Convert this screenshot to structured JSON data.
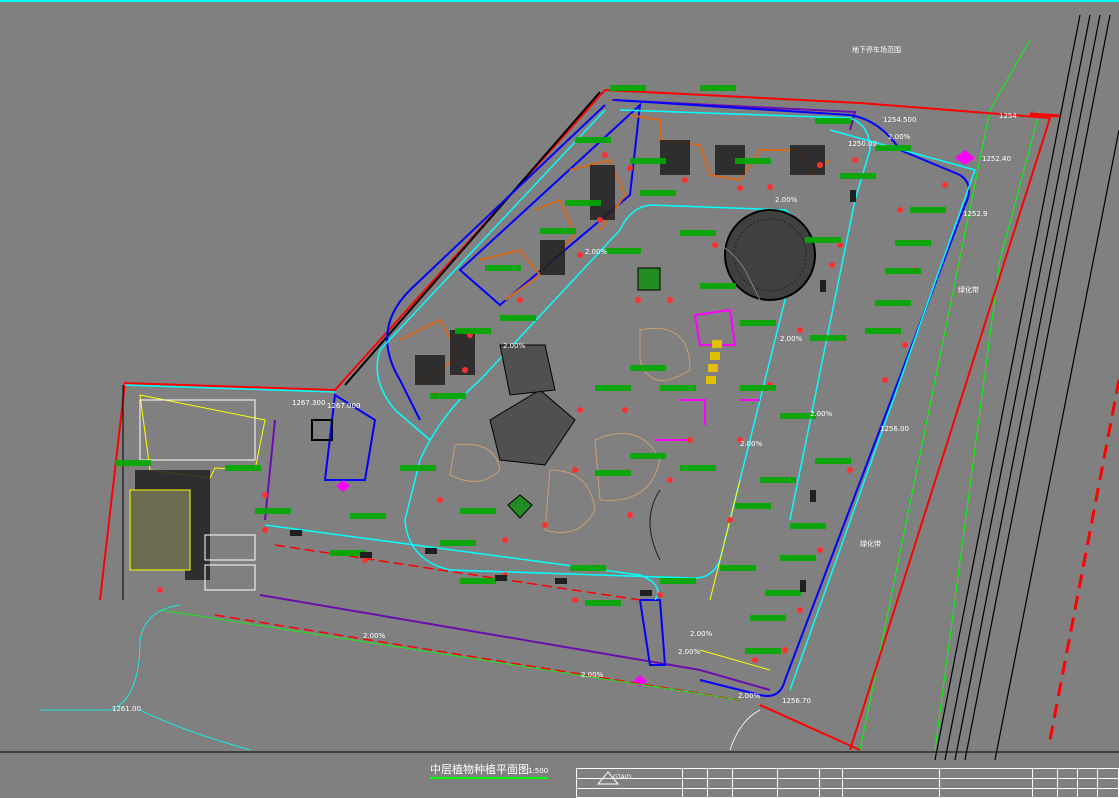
{
  "drawing": {
    "title": "中层植物种植平面图",
    "scale": "1:500",
    "top_note": "地下停车场范围",
    "elevations": [
      "1254",
      "1254.500",
      "1252.40",
      "1252.9",
      "1267.300",
      "1267.000",
      "1261.00",
      "1256.70",
      "1250.00",
      "1256.00"
    ],
    "dims": [
      "2.00%",
      "2.00%",
      "2.00%",
      "2.00%",
      "2.00%",
      "2.00%",
      "2.00%",
      "2.00%",
      "2.00%",
      "2.00%",
      "2.00%",
      "2.00%"
    ],
    "zones": {
      "green_belt_1": "绿化带",
      "green_belt_2": "绿化带"
    }
  },
  "colors": {
    "background": "#808080",
    "red_boundary": "#ff0000",
    "cyan": "#00ffff",
    "blue": "#0000ff",
    "purple": "#6a0dad",
    "magenta": "#ff00ff",
    "orange": "#d2691e",
    "green": "#00ff00",
    "yellow": "#ffff00",
    "black": "#000000",
    "tan": "#c8a070"
  },
  "titleblock": {
    "company": "GTAID"
  }
}
